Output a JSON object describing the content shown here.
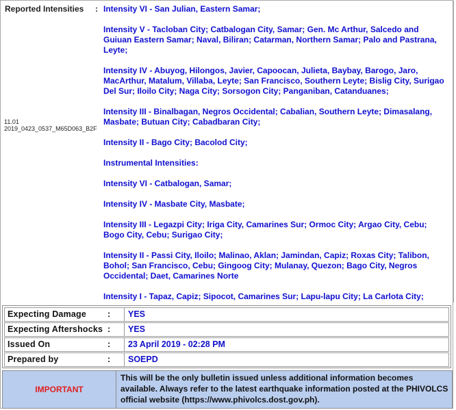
{
  "reported_intensities": {
    "label": "Reported Intensities",
    "colon": ":",
    "side_code": {
      "line1": "11.01",
      "line2": "2019_0423_0537_M65D063_B2F"
    },
    "paragraphs": [
      "Intensity VI - San Julian, Eastern Samar;",
      "Intensity V - Tacloban City; Catbalogan City, Samar; Gen. Mc Arthur, Salcedo and Guiuan Eastern Samar; Naval, Biliran; Catarman, Northern Samar; Palo and Pastrana, Leyte;",
      "Intensity IV - Abuyog, Hilongos, Javier, Capoocan, Julieta, Baybay, Barogo, Jaro, MacArthur, Matalum, Villaba, Leyte; San Francisco, Southern Leyte; Bislig City, Surigao Del Sur; Iloilo City; Naga City; Sorsogon City; Panganiban, Catanduanes;",
      "Intensity III - Binalbagan, Negros Occidental; Cabalian, Southern Leyte; Dimasalang, Masbate; Butuan City; Cabadbaran City;",
      "Intensity II - Bago City; Bacolod City;",
      "Instrumental Intensities:",
      "Intensity VI - Catbalogan, Samar;",
      "Intensity IV - Masbate City, Masbate;",
      "Intensity III - Legazpi City; Iriga City, Camarines Sur; Ormoc City; Argao City, Cebu; Bogo City, Cebu; Surigao City;",
      "Intensity II - Passi City, Iloilo; Malinao, Aklan; Jamindan, Capiz; Roxas City; Talibon, Bohol; San Francisco, Cebu; Gingoog City; Mulanay, Quezon; Bago City, Negros Occidental; Daet, Camarines Norte",
      "Intensity I - Tapaz, Capiz; Sipocot, Camarines Sur; Lapu-lapu City; La Carlota City;"
    ]
  },
  "info": {
    "rows": [
      {
        "label": "Expecting Damage",
        "colon": ":",
        "value": "YES"
      },
      {
        "label": "Expecting Aftershocks",
        "colon": ":",
        "value": "YES"
      },
      {
        "label": "Issued On",
        "colon": ":",
        "value": "23 April 2019 - 02:28 PM"
      },
      {
        "label": "Prepared by",
        "colon": ":",
        "value": "SOEPD"
      }
    ]
  },
  "important": {
    "label": "IMPORTANT",
    "text": "This will be the only bulletin issued unless additional information becomes available. Always refer to the latest earthquake information posted at the PHIVOLCS official website (https://www.phivolcs.dost.gov.ph)."
  },
  "colors": {
    "text_blue": "#1010d0",
    "important_red": "#e02020",
    "important_bg": "#b9cdee"
  }
}
